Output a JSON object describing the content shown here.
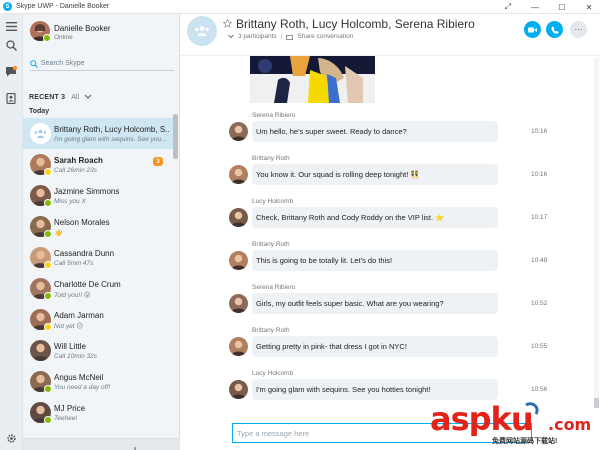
{
  "window": {
    "title": "Skype UWP - Danielle Booker",
    "logo_letter": "S",
    "controls": [
      "⤢",
      "—",
      "☐",
      "✕"
    ]
  },
  "me": {
    "name": "Danielle Booker",
    "status": "Online"
  },
  "search": {
    "placeholder": "Search Skype"
  },
  "recent": {
    "label": "RECENT 3",
    "filter": "All"
  },
  "section_label": "Today",
  "contacts": [
    {
      "name": "Brittany Roth, Lucy Holcomb, S...",
      "sub": "I'm going glam with sequins. See you...",
      "bold": false,
      "selected": true,
      "group": true,
      "presence": "",
      "color": "#cbe3f1"
    },
    {
      "name": "Sarah Roach",
      "sub": "Call 26min 23s",
      "bold": true,
      "badge": "3",
      "presence": "away",
      "color": "#b07a5a"
    },
    {
      "name": "Jazmine Simmons",
      "sub": "Miss you X",
      "presence": "on",
      "color": "#7c5a4a"
    },
    {
      "name": "Nelson Morales",
      "sub": "",
      "presence": "on",
      "color": "#8a6a4c",
      "emoji": "👋"
    },
    {
      "name": "Cassandra Dunn",
      "sub": "Call 5min 47s",
      "presence": "away",
      "color": "#c79a78"
    },
    {
      "name": "Charlotte De Crum",
      "sub": "Told you!!",
      "presence": "on",
      "color": "#a07560",
      "emoji": "😜"
    },
    {
      "name": "Adam Jarman",
      "sub": "Not yet",
      "presence": "away",
      "color": "#9b6e55",
      "emoji": "😐"
    },
    {
      "name": "Will Little",
      "sub": "Call 10min 32s",
      "presence": "",
      "color": "#6a5548"
    },
    {
      "name": "Angus McNeil",
      "sub": "You need a day off!",
      "presence": "on",
      "color": "#8b6a52"
    },
    {
      "name": "MJ Price",
      "sub": "Teehee!",
      "presence": "on",
      "color": "#5e4a40"
    }
  ],
  "sidebar_footer": {
    "add_label": "+",
    "more_label": "···"
  },
  "conversation": {
    "title": "Brittany Roth, Lucy Holcomb, Serena Ribiero",
    "participants": "3 participants",
    "share": "Share conversation",
    "messages": [
      {
        "sender": "Serena Ribiero",
        "text": "Um hello, he's super sweet. Ready to dance?",
        "time": "10:16",
        "color": "#8d6a58"
      },
      {
        "sender": "Brittany Roth",
        "text": "You know it. Our squad is rolling deep tonight!",
        "emoji": "👯",
        "time": "10:16",
        "color": "#b08060"
      },
      {
        "sender": "Lucy Holcomb",
        "text": "Check, Brittany Roth and Cody Roddy on the VIP list.",
        "emoji": "⭐",
        "time": "10:17",
        "color": "#7a5a48"
      },
      {
        "sender": "Brittany Roth",
        "text": "This is going to be totally lit. Let's do this!",
        "time": "10:48",
        "color": "#b08060"
      },
      {
        "sender": "Serena Ribiero",
        "text": "Girls, my outfit feels super basic. What are you wearing?",
        "time": "10:52",
        "color": "#8d6a58"
      },
      {
        "sender": "Brittany Roth",
        "text": "Getting pretty in pink- that dress I got in NYC!",
        "time": "10:55",
        "color": "#b08060"
      },
      {
        "sender": "Lucy Holcomb",
        "text": "I'm going glam with sequins. See you hotties tonight!",
        "time": "10:56",
        "color": "#7a5a48"
      }
    ]
  },
  "compose": {
    "placeholder": "Type a message here"
  },
  "watermark": {
    "text": "aspku",
    "domain": ".com",
    "caption": "免费网站源码下载站!"
  },
  "colors": {
    "accent": "#00aff0",
    "online": "#7fba00",
    "away": "#fcd116",
    "badge": "#f7941d"
  }
}
